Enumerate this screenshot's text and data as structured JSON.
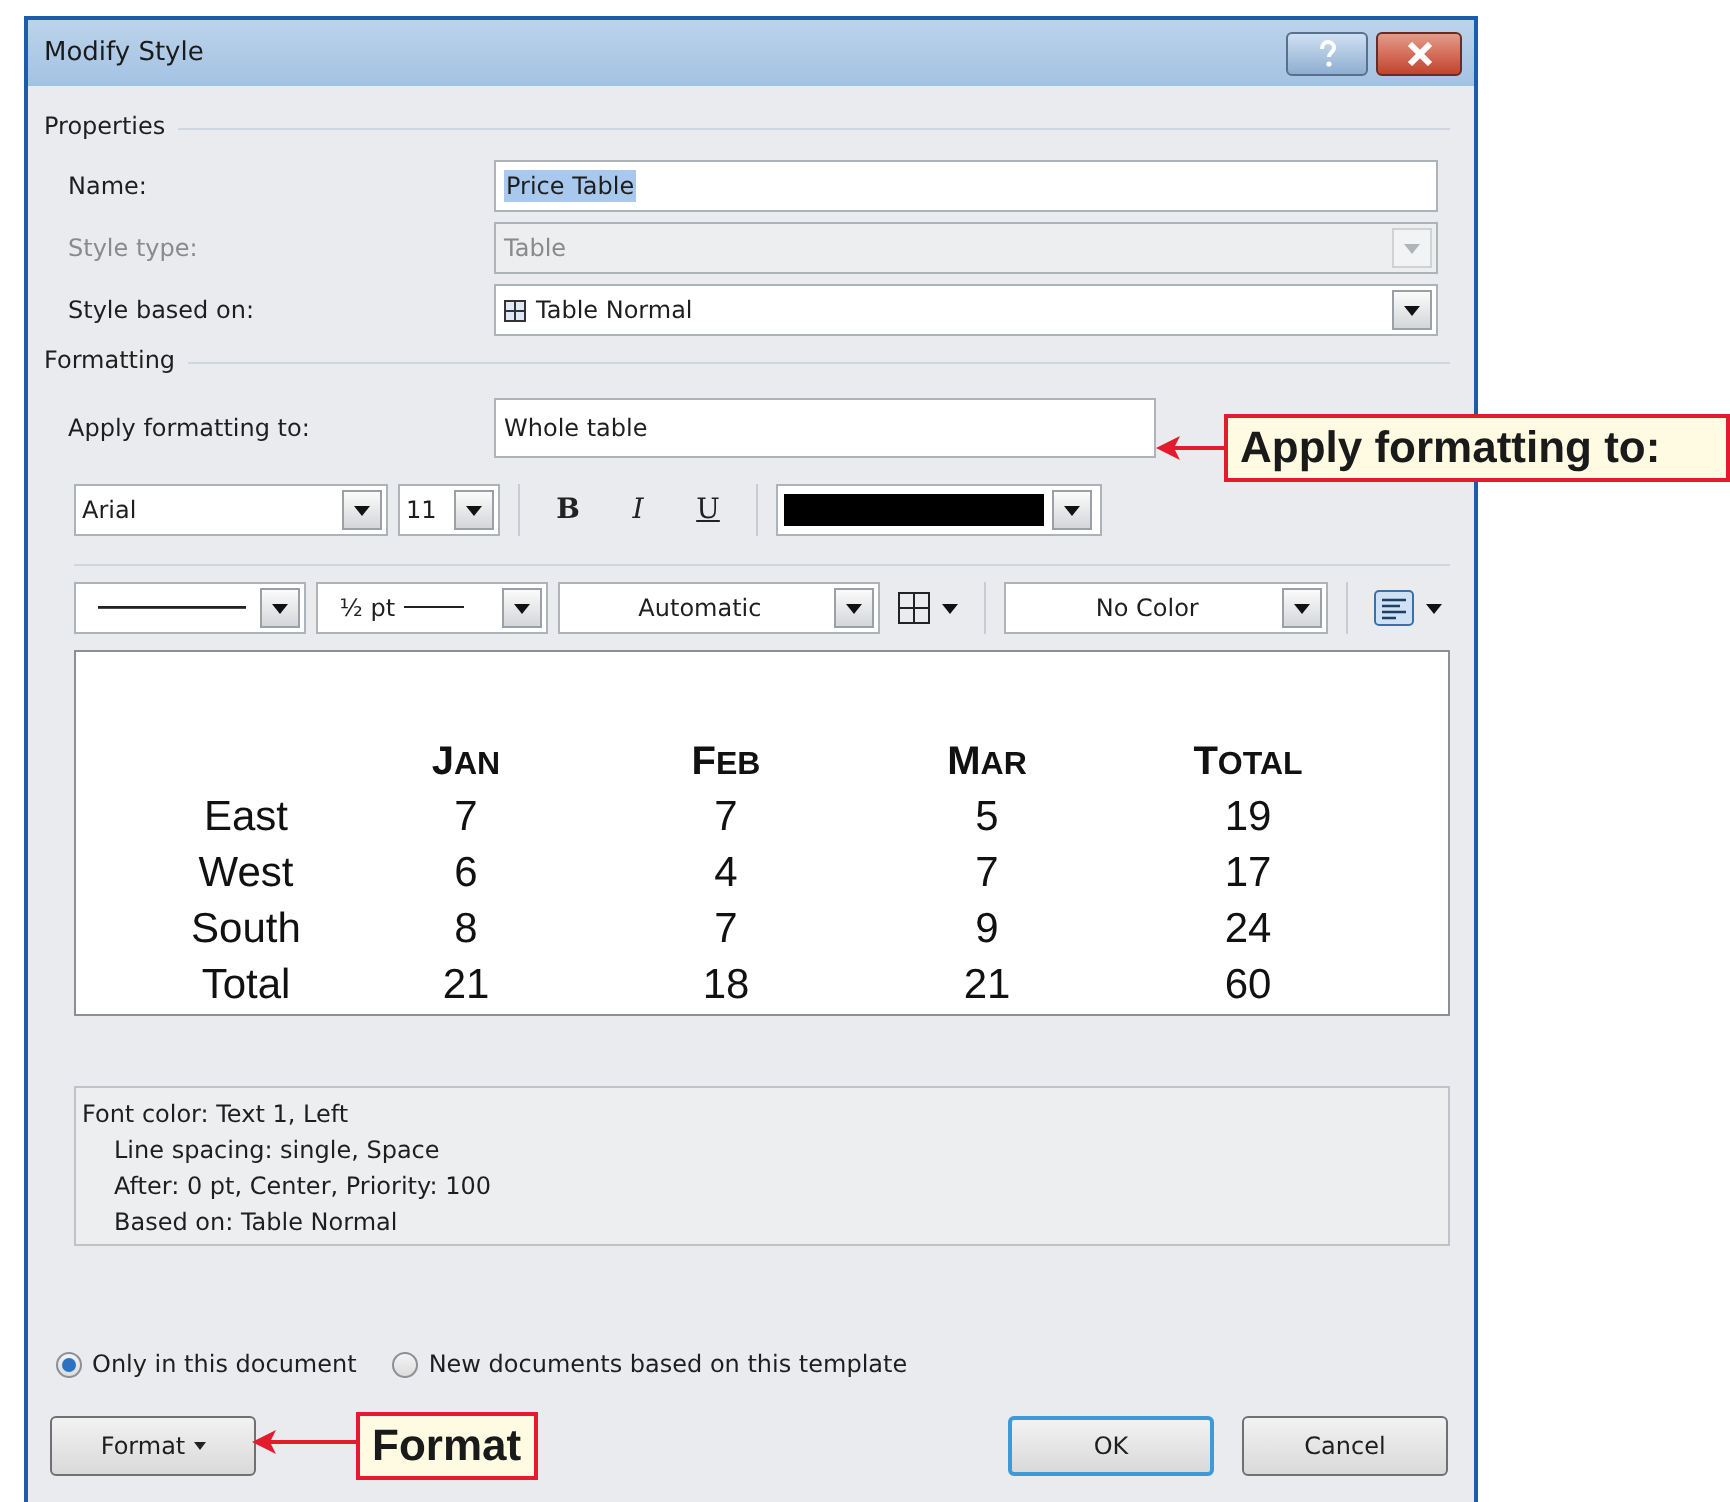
{
  "window": {
    "title": "Modify Style"
  },
  "properties": {
    "heading": "Properties",
    "fields": [
      {
        "label": "Name:",
        "kind": "text",
        "value": "Price Table",
        "value_selected": true,
        "disabled": false
      },
      {
        "label": "Style type:",
        "kind": "dropdown",
        "value": "Table",
        "value_selected": false,
        "disabled": true
      },
      {
        "label": "Style based on:",
        "kind": "style-dropdown",
        "value": "Table Normal",
        "value_selected": false,
        "disabled": false
      }
    ]
  },
  "formatting": {
    "heading": "Formatting",
    "apply_to": {
      "label": "Apply formatting to:",
      "value": "Whole table"
    },
    "font": {
      "name": "Arial",
      "size": "11",
      "styles": [
        {
          "label": "B",
          "kind": "bold"
        },
        {
          "label": "I",
          "kind": "italic"
        },
        {
          "label": "U",
          "kind": "underline"
        }
      ],
      "color": "#000000"
    },
    "borders": {
      "line_weight": "½ pt",
      "border_color": "Automatic",
      "shading": "No Color"
    }
  },
  "preview": {
    "columns": [
      "",
      "JAN",
      "FEB",
      "MAR",
      "TOTAL"
    ],
    "rows": [
      [
        "East",
        "7",
        "7",
        "5",
        "19"
      ],
      [
        "West",
        "6",
        "4",
        "7",
        "17"
      ],
      [
        "South",
        "8",
        "7",
        "9",
        "24"
      ],
      [
        "Total",
        "21",
        "18",
        "21",
        "60"
      ]
    ]
  },
  "description": [
    "Font color: Text 1, Left",
    "Line spacing:  single, Space",
    "After:  0 pt, Center, Priority: 100",
    "Based on: Table Normal"
  ],
  "scope": [
    {
      "label": "Only in this document",
      "selected": true
    },
    {
      "label": "New documents based on this template",
      "selected": false
    }
  ],
  "buttons": [
    {
      "label": "Format",
      "kind": "menu",
      "default": false
    },
    {
      "label": "OK",
      "kind": "plain",
      "default": true
    },
    {
      "label": "Cancel",
      "kind": "plain",
      "default": false
    }
  ],
  "callouts": [
    {
      "text": "Apply formatting to:"
    },
    {
      "text": "Format"
    }
  ]
}
